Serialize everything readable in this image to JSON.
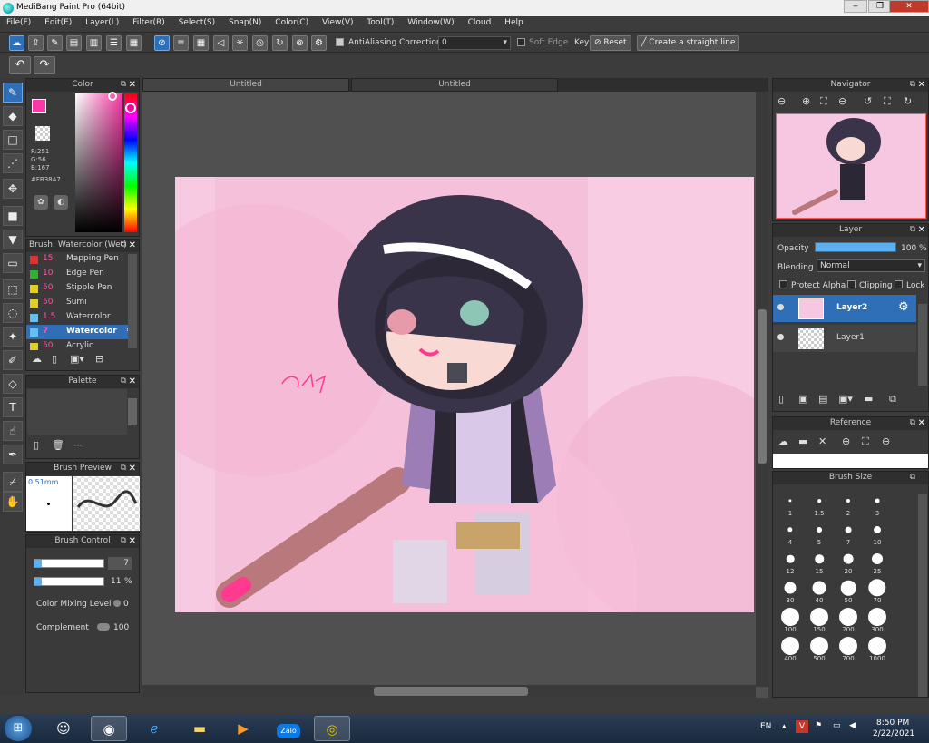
{
  "window": {
    "title": "MediBang Paint Pro (64bit)",
    "min_glyph": "‒",
    "max_glyph": "❐",
    "close_glyph": "✕"
  },
  "menu": [
    "File(F)",
    "Edit(E)",
    "Layer(L)",
    "Filter(R)",
    "Select(S)",
    "Snap(N)",
    "Color(C)",
    "View(V)",
    "Tool(T)",
    "Window(W)",
    "Cloud",
    "Help"
  ],
  "toolbar": {
    "antialiasing_label": "AntiAliasing",
    "correction_label": "Correction",
    "correction_value": "0",
    "soft_edge_label": "Soft Edge",
    "key_label": "Key",
    "reset_label": "Reset",
    "straight_line_label": "Create a straight line"
  },
  "color_panel": {
    "title": "Color",
    "r": "R:251",
    "g": "G:56",
    "b": "B:167",
    "hex": "#FB38A7",
    "fg_color": "#FB38A7"
  },
  "brush_panel": {
    "title": "Brush: Watercolor (Wet)",
    "items": [
      {
        "size": "15",
        "name": "Mapping Pen",
        "color": "#e03030"
      },
      {
        "size": "10",
        "name": "Edge Pen",
        "color": "#30b030"
      },
      {
        "size": "50",
        "name": "Stipple Pen",
        "color": "#e0d020"
      },
      {
        "size": "50",
        "name": "Sumi",
        "color": "#e0d020"
      },
      {
        "size": "1.5",
        "name": "Watercolor",
        "color": "#60c0f0"
      },
      {
        "size": "7",
        "name": "Watercolor",
        "color": "#60c0f0",
        "selected": true
      },
      {
        "size": "50",
        "name": "Acrylic",
        "color": "#e0d020"
      }
    ]
  },
  "palette_panel": {
    "title": "Palette",
    "value": "---"
  },
  "brush_preview": {
    "title": "Brush Preview",
    "size_label": "0.51mm"
  },
  "brush_control": {
    "title": "Brush Control",
    "size_value": "7",
    "opacity_value": "11",
    "opacity_unit": "%",
    "color_mixing_label": "Color Mixing Level",
    "color_mixing_value": "0",
    "complement_label": "Complement",
    "complement_value": "100"
  },
  "tabs": [
    "Untitled",
    "Untitled"
  ],
  "navigator": {
    "title": "Navigator"
  },
  "layer_panel": {
    "title": "Layer",
    "opacity_label": "Opacity",
    "opacity_value": "100 %",
    "opacity_level": 1.0,
    "blending_label": "Blending",
    "blending_value": "Normal",
    "protect_alpha": "Protect Alpha",
    "clipping": "Clipping",
    "lock": "Lock",
    "layers": [
      "Layer2",
      "Layer1"
    ]
  },
  "reference_panel": {
    "title": "Reference"
  },
  "brush_size_panel": {
    "title": "Brush Size",
    "sizes": [
      "1",
      "1.5",
      "2",
      "3",
      "4",
      "5",
      "7",
      "10",
      "12",
      "15",
      "20",
      "25",
      "30",
      "40",
      "50",
      "70",
      "100",
      "150",
      "200",
      "300",
      "400",
      "500",
      "700",
      "1000"
    ]
  },
  "canvas": {
    "signature": "@lily"
  },
  "taskbar": {
    "language": "EN",
    "time": "8:50 PM",
    "date": "2/22/2021",
    "zalo_label": "Zalo"
  },
  "colors": {
    "accent": "#2f6fb8",
    "canvas_pink": "#f7c6e0"
  }
}
